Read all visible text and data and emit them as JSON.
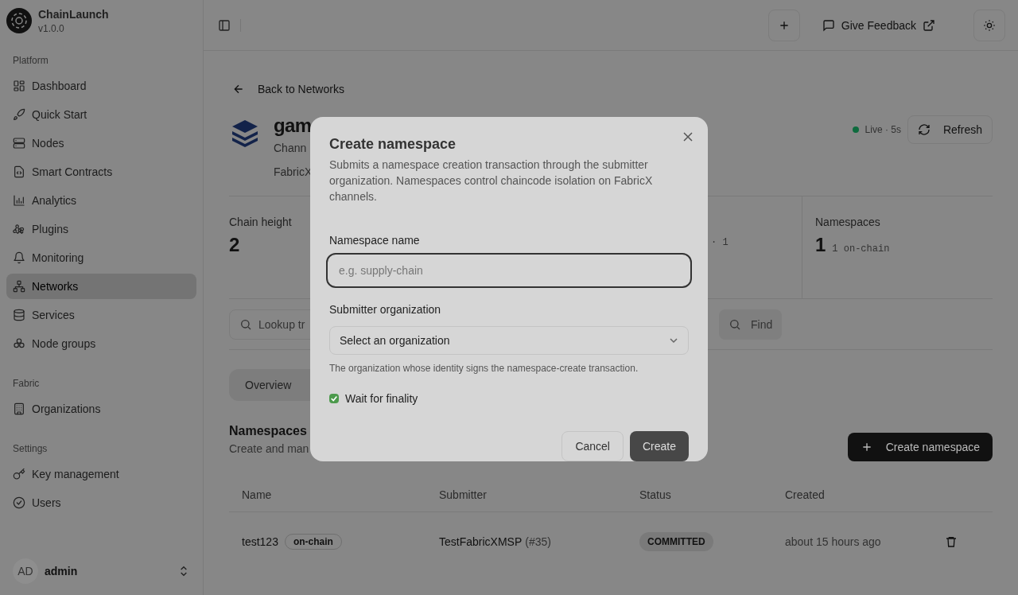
{
  "app": {
    "name": "ChainLaunch",
    "version": "v1.0.0"
  },
  "sidebar": {
    "sections": [
      {
        "label": "Platform",
        "items": [
          {
            "label": "Dashboard",
            "selected": false
          },
          {
            "label": "Quick Start",
            "selected": false
          },
          {
            "label": "Nodes",
            "selected": false
          },
          {
            "label": "Smart Contracts",
            "selected": false
          },
          {
            "label": "Analytics",
            "selected": false
          },
          {
            "label": "Plugins",
            "selected": false
          },
          {
            "label": "Monitoring",
            "selected": false
          },
          {
            "label": "Networks",
            "selected": true
          },
          {
            "label": "Services",
            "selected": false
          },
          {
            "label": "Node groups",
            "selected": false
          }
        ]
      },
      {
        "label": "Fabric",
        "items": [
          {
            "label": "Organizations",
            "selected": false
          }
        ]
      },
      {
        "label": "Settings",
        "items": [
          {
            "label": "Key management",
            "selected": false
          },
          {
            "label": "Users",
            "selected": false
          }
        ]
      }
    ]
  },
  "user": {
    "initials": "AD",
    "name": "admin"
  },
  "topbar": {
    "feedback": "Give Feedback"
  },
  "back_link": "Back to Networks",
  "network": {
    "name": "gam",
    "channel_label": "Chann",
    "description": "FabricX"
  },
  "live": {
    "label": "Live · 5s"
  },
  "refresh": "Refresh",
  "stats": [
    {
      "label": "Chain height",
      "value": "2"
    },
    {
      "detail": "· 1"
    },
    {
      "label": "Namespaces",
      "value": "1",
      "detail": "1 on-chain"
    }
  ],
  "lookup": {
    "placeholder": "Lookup tr",
    "button": "Find"
  },
  "tabs": [
    {
      "label": "Overview",
      "selected": false
    }
  ],
  "section": {
    "title": "Namespaces",
    "subtitle": "Create and man",
    "button": "Create namespace"
  },
  "table": {
    "columns": [
      "Name",
      "Submitter",
      "Status",
      "Created"
    ],
    "rows": [
      {
        "name": "test123",
        "badge": "on-chain",
        "submitter": "TestFabricXMSP",
        "submitter_id": "(#35)",
        "status": "COMMITTED",
        "created": "about 15 hours ago"
      }
    ]
  },
  "dialog": {
    "title": "Create namespace",
    "description": "Submits a namespace creation transaction through the submitter organization. Namespaces control chaincode isolation on FabricX channels.",
    "name_label": "Namespace name",
    "name_placeholder": "e.g. supply-chain",
    "org_label": "Submitter organization",
    "org_placeholder": "Select an organization",
    "org_hint": "The organization whose identity signs the namespace-create transaction.",
    "wait": {
      "label": "Wait for finality",
      "checked": true
    },
    "buttons": [
      "Cancel",
      "Create"
    ]
  }
}
